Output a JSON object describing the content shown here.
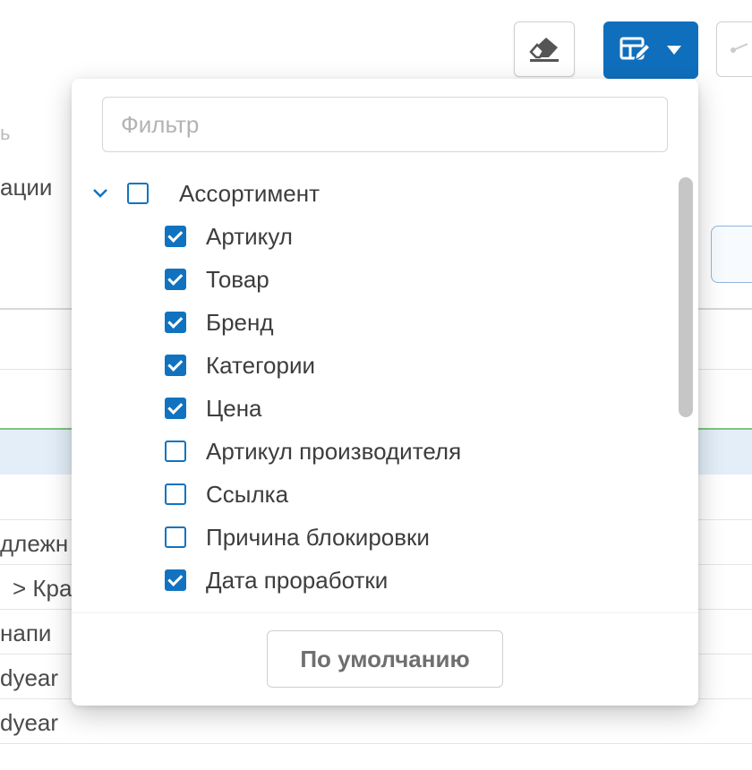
{
  "background": {
    "text_fragments": [
      "ь",
      "ации",
      "длежн",
      "> Кра",
      "напи",
      "dyear",
      "dyear"
    ]
  },
  "toolbar": {
    "eraser_icon": "eraser-icon",
    "columns_icon": "table-edit-icon",
    "dropdown_icon": "caret-down-icon",
    "accent_color": "#0f6fbd"
  },
  "column_menu": {
    "filter_placeholder": "Фильтр",
    "filter_value": "",
    "groups": [
      {
        "label": "Ассортимент",
        "expanded": true,
        "checked": false,
        "items": [
          {
            "label": "Артикул",
            "checked": true
          },
          {
            "label": "Товар",
            "checked": true
          },
          {
            "label": "Бренд",
            "checked": true
          },
          {
            "label": "Категории",
            "checked": true
          },
          {
            "label": "Цена",
            "checked": true
          },
          {
            "label": "Артикул производителя",
            "checked": false
          },
          {
            "label": "Ссылка",
            "checked": false
          },
          {
            "label": "Причина блокировки",
            "checked": false
          },
          {
            "label": "Дата проработки",
            "checked": true
          }
        ]
      }
    ],
    "default_button_label": "По умолчанию"
  }
}
